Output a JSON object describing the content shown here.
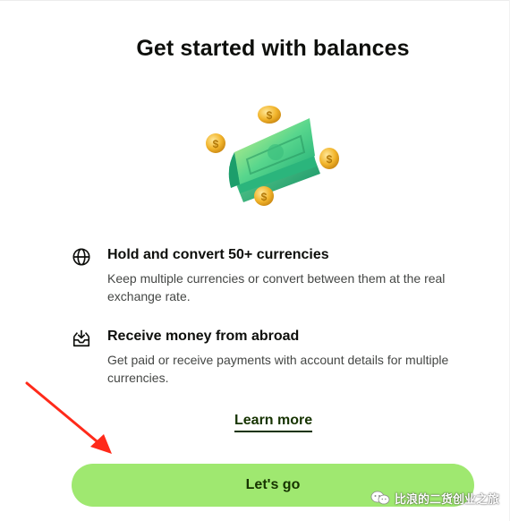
{
  "page": {
    "title": "Get started with balances"
  },
  "features": [
    {
      "icon": "globe-icon",
      "title": "Hold and convert 50+ currencies",
      "description": "Keep multiple currencies or convert between them at the real exchange rate."
    },
    {
      "icon": "inbox-download-icon",
      "title": "Receive money from abroad",
      "description": "Get paid or receive payments with account details for multiple currencies."
    }
  ],
  "links": {
    "learn_more": "Learn more"
  },
  "cta": {
    "label": "Let's go"
  },
  "annotation": {
    "arrow": "red-arrow-icon",
    "color": "#ff2a1a"
  },
  "watermark": {
    "icon": "wechat-icon",
    "text": "比浪的二货创业之旅"
  },
  "colors": {
    "accent": "#9fe870",
    "accent_text": "#163300",
    "body_text": "#0e0f0c",
    "secondary_text": "#454745"
  }
}
